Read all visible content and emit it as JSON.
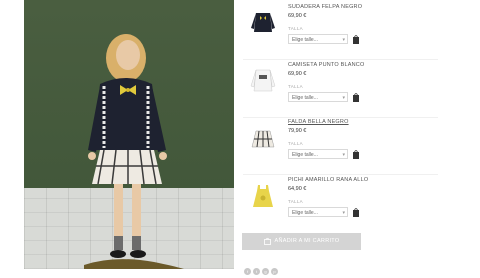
{
  "products": [
    {
      "name": "SUDADERA FELPA NEGRO",
      "price": "69,90 €",
      "size_label": "TALLA",
      "size_placeholder": "Elige talle...",
      "thumb": "black-sweatshirt"
    },
    {
      "name": "CAMISETA PUNTO BLANCO",
      "price": "69,90 €",
      "size_label": "TALLA",
      "size_placeholder": "Elige talle...",
      "thumb": "white-shirt"
    },
    {
      "name": "FALDA BELLA NEGRO",
      "price": "79,90 €",
      "size_label": "TALLA",
      "size_placeholder": "Elige talle...",
      "thumb": "plaid-skirt"
    },
    {
      "name": "PICHI AMARILLO RANA ALLO",
      "price": "64,90 €",
      "size_label": "TALLA",
      "size_placeholder": "Elige talle...",
      "thumb": "yellow-dress"
    }
  ],
  "add_to_cart_label": "AÑADIR A MI CARRITO",
  "social_icons": [
    "facebook-icon",
    "twitter-icon",
    "google-plus-icon",
    "pinterest-icon"
  ],
  "colors": {
    "backdrop": "#4a5e40",
    "button": "#d4d4d4",
    "accent_yellow": "#e0c93c"
  }
}
